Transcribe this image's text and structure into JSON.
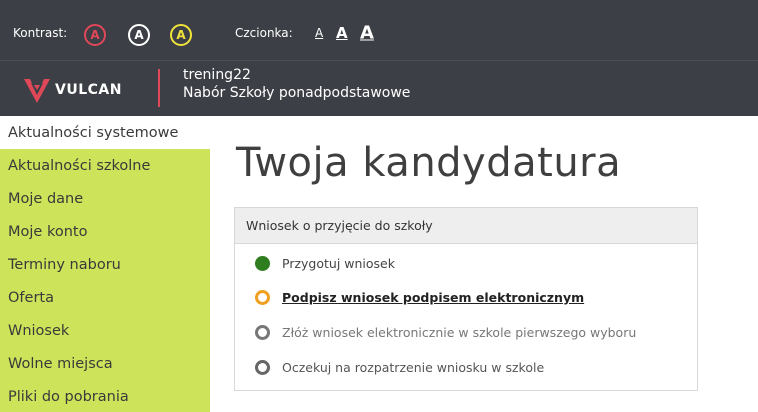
{
  "accessibility": {
    "kontrast_label": "Kontrast:",
    "contrast_buttons": [
      "A",
      "A",
      "A"
    ],
    "czcionka_label": "Czcionka:",
    "font_buttons": [
      "A",
      "A",
      "A"
    ]
  },
  "header": {
    "logo_text": "VULCAN",
    "site_line1": "trening22",
    "site_line2": "Nabór Szkoły ponadpodstawowe"
  },
  "sidebar": {
    "items": [
      {
        "label": "Aktualności systemowe"
      },
      {
        "label": "Aktualności szkolne"
      },
      {
        "label": "Moje dane"
      },
      {
        "label": "Moje konto"
      },
      {
        "label": "Terminy naboru"
      },
      {
        "label": "Oferta"
      },
      {
        "label": "Wniosek"
      },
      {
        "label": "Wolne miejsca"
      },
      {
        "label": "Pliki do pobrania"
      }
    ]
  },
  "main": {
    "title": "Twoja kandydatura",
    "panel_title": "Wniosek o przyjęcie do szkoły",
    "steps": [
      {
        "label": "Przygotuj wniosek"
      },
      {
        "label": "Podpisz wniosek podpisem elektronicznym"
      },
      {
        "label": "Złóż wniosek elektronicznie w szkole pierwszego wyboru"
      },
      {
        "label": "Oczekuj na rozpatrzenie wniosku w szkole"
      }
    ]
  },
  "colors": {
    "topbar": "#3c3f45",
    "accent_red": "#e0485a",
    "sidebar_green": "#cce35a",
    "step_done": "#2e7d1f",
    "step_current": "#f0a020"
  }
}
